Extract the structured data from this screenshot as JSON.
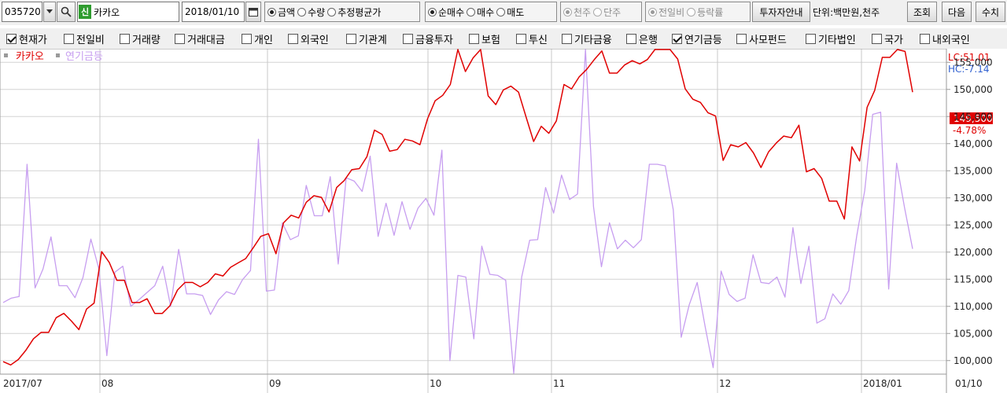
{
  "toolbar": {
    "code": "035720",
    "shin_label": "신",
    "stock_name": "카카오",
    "date": "2018/01/10",
    "amount_group": [
      "금액",
      "수량",
      "추정평균가"
    ],
    "amount_selected": 0,
    "trade_group": [
      "순매수",
      "매수",
      "매도"
    ],
    "trade_selected": 0,
    "unit_group": [
      "천주",
      "단주"
    ],
    "unit_selected": 0,
    "compare_group": [
      "전일비",
      "등락률"
    ],
    "compare_selected": 0,
    "investor_button": "투자자안내",
    "unit_text": "단위:백만원,천주",
    "query_button": "조회",
    "next_button": "다음",
    "manual_button": "수치"
  },
  "checkboxes": [
    {
      "label": "현재가",
      "checked": true
    },
    {
      "label": "전일비",
      "checked": false
    },
    {
      "label": "거래량",
      "checked": false
    },
    {
      "label": "거래대금",
      "checked": false
    },
    {
      "label": "개인",
      "checked": false
    },
    {
      "label": "외국인",
      "checked": false
    },
    {
      "label": "기관계",
      "checked": false
    },
    {
      "label": "금융투자",
      "checked": false
    },
    {
      "label": "보험",
      "checked": false
    },
    {
      "label": "투신",
      "checked": false
    },
    {
      "label": "기타금융",
      "checked": false
    },
    {
      "label": "은행",
      "checked": false
    },
    {
      "label": "연기금등",
      "checked": true
    },
    {
      "label": "사모펀드",
      "checked": false
    },
    {
      "label": "기타법인",
      "checked": false
    },
    {
      "label": "국가",
      "checked": false
    },
    {
      "label": "내외국인",
      "checked": false
    }
  ],
  "colors": {
    "price": "#e00000",
    "pension": "#c79ef0",
    "lc": "#e00000",
    "hc": "#3060d0",
    "current_bg": "#e00000"
  },
  "chart": {
    "legend_price": "카카오",
    "legend_pension": "연기금등",
    "lc_label": "LC:51.01",
    "hc_label": "HC:-7.14",
    "current_price": "149,500",
    "current_change": "-4.78%",
    "bottom_right": "01/10",
    "y_ticks": [
      "155,000",
      "150,000",
      "145,000",
      "140,000",
      "135,000",
      "130,000",
      "125,000",
      "120,000",
      "115,000",
      "110,000",
      "105,000",
      "100,000"
    ]
  },
  "chart_data": {
    "type": "line",
    "x_labels": [
      "2017/07",
      "08",
      "09",
      "10",
      "11",
      "12",
      "2018/01"
    ],
    "ylim": [
      97500,
      157500
    ],
    "series": [
      {
        "name": "카카오",
        "values": [
          99800,
          99200,
          100200,
          101900,
          104000,
          105200,
          105200,
          107900,
          108700,
          107300,
          105700,
          109500,
          110600,
          120100,
          118100,
          114800,
          114800,
          110700,
          110700,
          111400,
          108700,
          108700,
          110100,
          113000,
          114400,
          114400,
          113600,
          114400,
          116000,
          115600,
          117200,
          118000,
          118800,
          120800,
          122900,
          123400,
          119700,
          125400,
          126800,
          126300,
          129200,
          130400,
          130100,
          127400,
          131900,
          133200,
          135200,
          135400,
          137600,
          142500,
          141700,
          138600,
          138900,
          140800,
          140500,
          139800,
          144600,
          147900,
          148900,
          150900,
          159500,
          153300,
          155800,
          157900,
          148800,
          147200,
          149900,
          150600,
          149500,
          144900,
          140400,
          143200,
          141900,
          144200,
          150900,
          150100,
          152300,
          153700,
          155500,
          157100,
          153000,
          153000,
          154500,
          155300,
          154700,
          155500,
          158800,
          160500,
          161200,
          155600,
          150100,
          148200,
          147600,
          145700,
          145100,
          136900,
          139800,
          139400,
          140200,
          138300,
          135600,
          138500,
          140100,
          141400,
          141100,
          143400,
          134800,
          135400,
          133600,
          129400,
          129400,
          126100,
          139400,
          136800,
          146700,
          149800,
          155900,
          155900,
          160800,
          157000,
          149500
        ]
      },
      {
        "name": "연기금등",
        "values": [
          110700,
          111500,
          111800,
          136200,
          113400,
          116900,
          122800,
          113800,
          113800,
          111600,
          115300,
          122400,
          116900,
          100900,
          116300,
          117400,
          110000,
          111200,
          112500,
          113800,
          117400,
          110000,
          120500,
          112300,
          112300,
          112000,
          108500,
          111200,
          112700,
          112200,
          114900,
          116600,
          140800,
          112800,
          113000,
          125400,
          122300,
          123000,
          132300,
          126700,
          126700,
          133900,
          117800,
          133700,
          133100,
          131200,
          137700,
          122900,
          129000,
          123100,
          129300,
          124200,
          128100,
          129900,
          126800,
          138800,
          100000,
          115700,
          115400,
          104000,
          121100,
          115900,
          115700,
          114800,
          97300,
          115400,
          122200,
          122300,
          131900,
          127200,
          134200,
          129700,
          130700,
          160700,
          128400,
          117300,
          125400,
          120600,
          122200,
          120800,
          122300,
          136200,
          136200,
          135900,
          127800,
          104300,
          110300,
          114400,
          106200,
          98700,
          116500,
          112200,
          110900,
          111500,
          119500,
          114400,
          114200,
          115400,
          111700,
          124500,
          114200,
          121100,
          106900,
          107700,
          112300,
          110400,
          112900,
          123000,
          131400,
          145400,
          145800,
          113200,
          136400,
          128100,
          120600
        ]
      }
    ]
  }
}
